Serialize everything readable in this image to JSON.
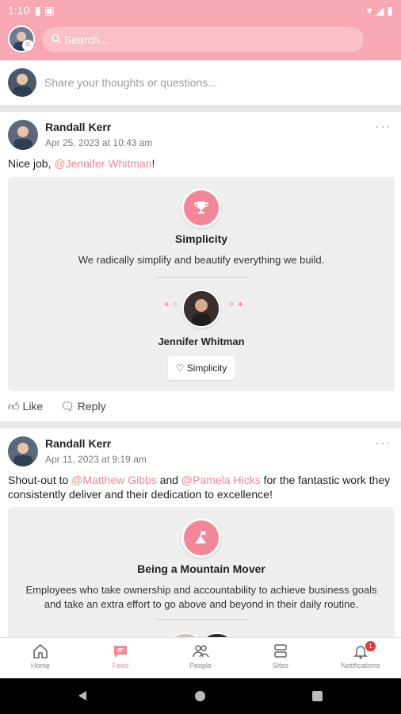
{
  "status_bar": {
    "time": "1:10"
  },
  "header": {
    "search_placeholder": "Search..."
  },
  "composer": {
    "placeholder": "Share your thoughts or questions..."
  },
  "posts": [
    {
      "author": "Randall Kerr",
      "date": "Apr 25, 2023 at 10:43 am",
      "text_prefix": "Nice job, ",
      "mention1": "@Jennifer Whitman",
      "text_suffix": "!",
      "award": {
        "title": "Simplicity",
        "description": "We radically simplify and beautify everything we build.",
        "recipient": "Jennifer Whitman",
        "chip_label": "Simplicity"
      },
      "like_label": "Like",
      "reply_label": "Reply"
    },
    {
      "author": "Randall Kerr",
      "date": "Apr 11, 2023 at 9:19 am",
      "text_prefix": "Shout-out to ",
      "mention1": "@Matthew Gibbs",
      "text_mid": " and ",
      "mention2": "@Pamela Hicks",
      "text_suffix": " for the fantastic work they consistently deliver and their dedication to excellence!",
      "award": {
        "title": "Being a Mountain Mover",
        "description": "Employees who take ownership and accountability to achieve business goals and take an extra effort to go above and beyond in their daily routine."
      }
    }
  ],
  "bottom_nav": {
    "items": [
      {
        "label": "Home",
        "icon": "home-icon"
      },
      {
        "label": "Feed",
        "icon": "feed-icon"
      },
      {
        "label": "People",
        "icon": "people-icon"
      },
      {
        "label": "Sites",
        "icon": "sites-icon"
      },
      {
        "label": "Notifications",
        "icon": "bell-icon"
      }
    ],
    "active": "Feed",
    "notification_count": "1"
  },
  "colors": {
    "brand": "#f8a8b3",
    "accent": "#f48797"
  }
}
